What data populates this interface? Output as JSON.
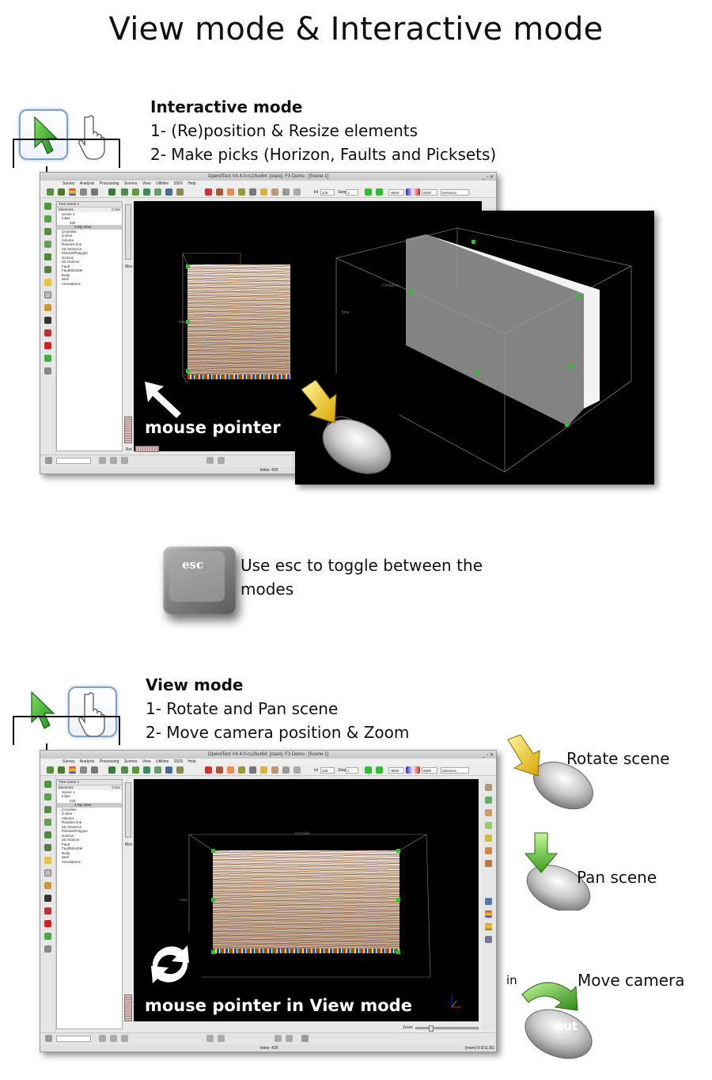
{
  "page_title": "View mode & Interactive mode",
  "interactive": {
    "heading": "Interactive mode",
    "line1": "1- (Re)position & Resize elements",
    "line2": "2- Make picks (Horizon, Faults and Picksets)",
    "overlay_label": "mouse pointer"
  },
  "esc": {
    "key_label": "esc",
    "text": "Use esc to toggle between the modes"
  },
  "view": {
    "heading": "View mode",
    "line1": "1- Rotate and Pan scene",
    "line2": "2- Move camera position & Zoom",
    "overlay_label": "mouse pointer in View mode"
  },
  "mouse_actions": {
    "rotate": "Rotate scene",
    "pan": "Pan scene",
    "move": "Move camera",
    "in": "in",
    "out": "out"
  },
  "app": {
    "title": "OpendTect V4.4.0-rc2/lux64: [clare]: F3 Demo : [Scene 1]",
    "menus": [
      "Survey",
      "Analysis",
      "Processing",
      "Scenes",
      "View",
      "Utilities",
      "SSIS",
      "Help"
    ],
    "inl_label": "Inl",
    "inl_value": "425",
    "step_label": "Step",
    "step_value": "1",
    "range_min": "-8500",
    "range_max": "8500",
    "colortable": "Seismics",
    "tree_title": "Tree scene 1",
    "tree_col_elements": "Elements",
    "tree_col_color": "Color",
    "tree_items": [
      "Scene 1",
      "Inline",
      "425",
      "4 Dip steer",
      "Crossline",
      "Z-slice",
      "Volume",
      "Random line",
      "2D Seismics",
      "PickSet/Polygon",
      "Horizon",
      "2D Horizon",
      "Fault",
      "FaultStickSet",
      "Body",
      "Well",
      "Annotations"
    ],
    "mov_label": "Mov",
    "rot_label": "Rot",
    "zoom_label": "Zoom",
    "status_inline": "Inline: 425",
    "status_mem": "[mem] 9.9/11.8G",
    "axis_time": "Time",
    "axis_crossline": "Crossline"
  }
}
